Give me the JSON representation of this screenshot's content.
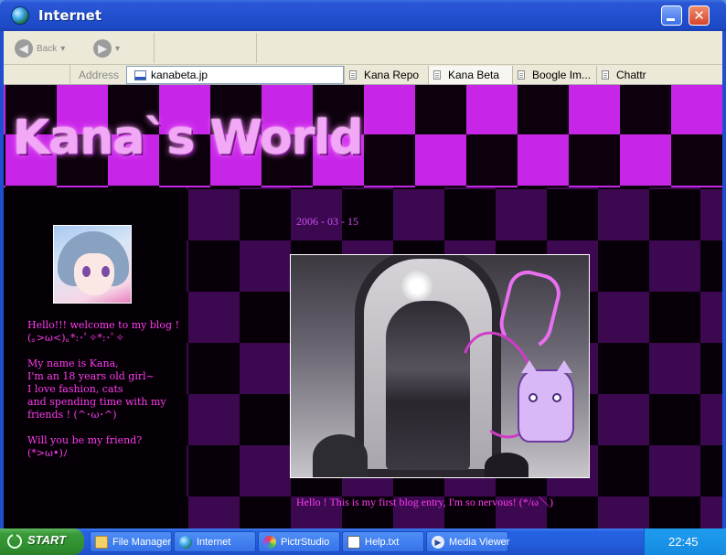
{
  "window": {
    "title": "Internet"
  },
  "toolbar": {
    "back_label": "Back",
    "back_arrow": "◀",
    "forward_arrow": "▶",
    "dropdown": "▾"
  },
  "address": {
    "label": "Address",
    "url": "kanabeta.jp",
    "tabs": [
      {
        "label": "Kana Repo"
      },
      {
        "label": "Kana Beta"
      },
      {
        "label": "Boogle Im..."
      },
      {
        "label": "Chattr"
      }
    ]
  },
  "site": {
    "title": "Kana`s World",
    "sidebar_paragraphs": [
      [
        "Hello!!! welcome to my blog !",
        "(｡>ω<)｡*:･ﾟ✧*:･ﾟ✧"
      ],
      [
        "My name is Kana,",
        "I'm an 18 years old girl~",
        "I love fashion, cats",
        "and spending time with my",
        "friends ! (^･ω･^)"
      ],
      [
        "Will you be my friend?",
        "(*>ω•)ﾉ"
      ]
    ],
    "post": {
      "date": "2006 - 03 - 15",
      "text": "Hello ! This is my first blog entry, I'm so nervous! (*/ω＼)"
    }
  },
  "taskbar": {
    "start_label": "START",
    "tasks": [
      {
        "label": "File Manager",
        "icon": "folder-icon"
      },
      {
        "label": "Internet",
        "icon": "globe-icon"
      },
      {
        "label": "PictrStudio",
        "icon": "paint-icon"
      },
      {
        "label": "Help.txt",
        "icon": "notepad-icon"
      },
      {
        "label": "Media Viewer",
        "icon": "play-icon"
      }
    ],
    "clock": "22:45"
  }
}
